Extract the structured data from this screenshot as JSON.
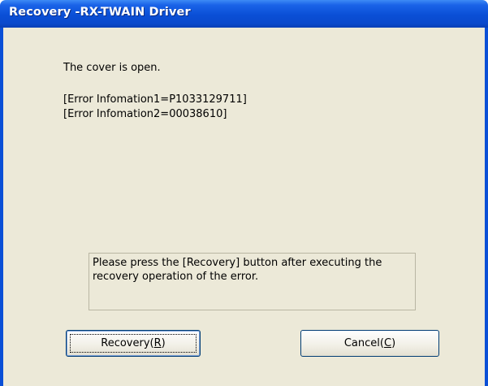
{
  "window": {
    "title": "Recovery -RX-TWAIN Driver"
  },
  "content": {
    "message": "The cover is open.",
    "error_info_1": "[Error Infomation1=P1033129711]",
    "error_info_2": "[Error Infomation2=00038610]",
    "instruction": "Please press the [Recovery] button after executing the recovery operation of the error."
  },
  "buttons": {
    "recovery": {
      "label": "Recovery(",
      "mnemonic": "R",
      "suffix": ")"
    },
    "cancel": {
      "label": "Cancel(",
      "mnemonic": "C",
      "suffix": ")"
    }
  },
  "colors": {
    "titlebar": "#0a4fd6",
    "dialog_bg": "#ece9d8",
    "button_border": "#003c74"
  }
}
